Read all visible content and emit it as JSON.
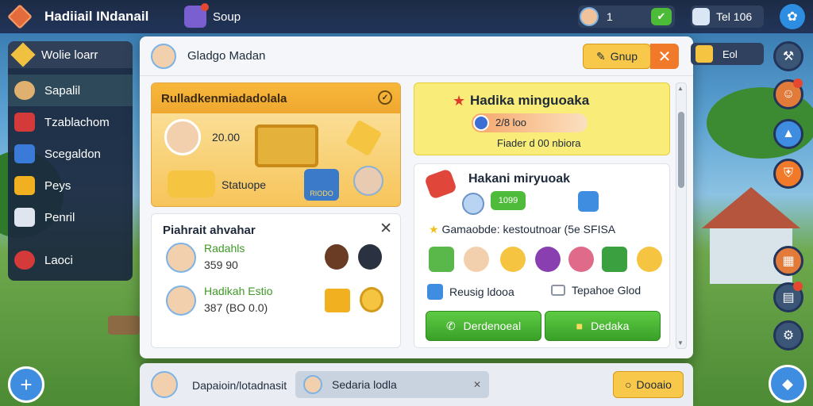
{
  "header": {
    "title": "Hadiiail INdanail",
    "soup_label": "Soup",
    "resource1_value": "1",
    "resource2_value": "Tel  106"
  },
  "sidebar": {
    "items": [
      {
        "label": "Wolie loarr",
        "icon": "pencil-icon"
      },
      {
        "label": "Sapalil",
        "icon": "character-icon",
        "active": true
      },
      {
        "label": "Tzablachom",
        "icon": "map-icon"
      },
      {
        "label": "Scegaldon",
        "icon": "box-icon"
      },
      {
        "label": "Peys",
        "icon": "chest-icon"
      },
      {
        "label": "Penril",
        "icon": "cube-icon"
      },
      {
        "label": "Laoci",
        "icon": "target-icon"
      }
    ]
  },
  "dialog": {
    "title": "Gladgo Madan",
    "group_button": "Gnup",
    "banner": {
      "title": "Rulladkenmiadadolala",
      "points": "20.00",
      "subtitle": "Statuope",
      "badge": "RIODO"
    },
    "friends": {
      "title": "Piahrait ahvahar",
      "rows": [
        {
          "name": "Radahls",
          "value": "359 90"
        },
        {
          "name": "Hadikah Estio",
          "value": "387 (BO 0.0)"
        }
      ]
    },
    "quest": {
      "title": "Hadika minguoaka",
      "progress_text": "2/8 loo",
      "subtitle": "Fiader d 00 nbiora"
    },
    "actions": {
      "title": "Hakani miryuoak",
      "pill": "1099",
      "info_line": "Gamaobde: kestoutnoar (5e SFISA",
      "option1": "Reusig ldooa",
      "option2": "Tepahoe Glod",
      "button1": "Derdenoeal",
      "button2": "Dedaka"
    }
  },
  "bottombar": {
    "text": "Dapaioin/lotadnasit",
    "input_value": "Sedaria lodla",
    "button": "Dooaio"
  },
  "side_panel": {
    "label": "Eol"
  },
  "colors": {
    "accent_orange": "#f07a2a",
    "accent_yellow": "#f8c84a",
    "accent_green": "#4fbb3a",
    "accent_blue": "#3e8de0"
  }
}
